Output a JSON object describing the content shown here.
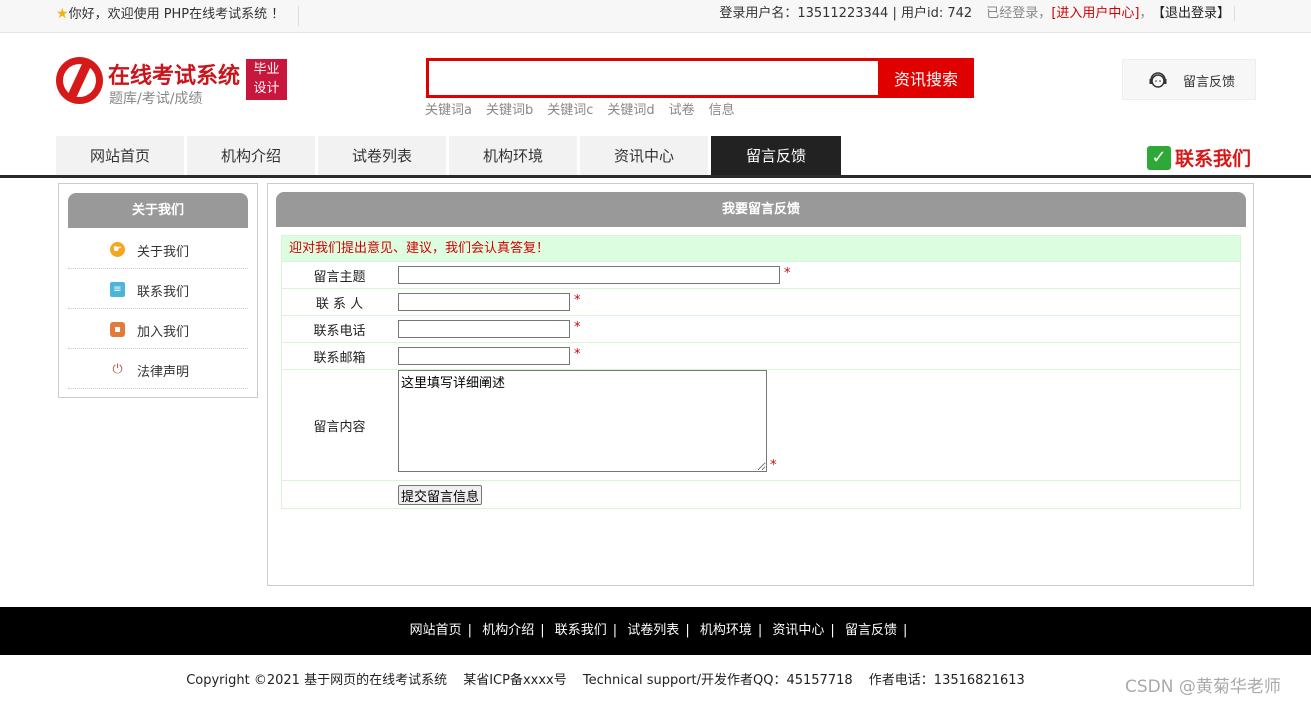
{
  "topbar": {
    "welcome": "你好，欢迎使用 PHP在线考试系统 ！",
    "user_label": "登录用户名：13511223344 | 用户id: 742",
    "logged_in": "已经登录，",
    "user_center": "[进入用户中心]",
    "comma": "，",
    "logout": "【退出登录】"
  },
  "logo": {
    "title": "在线考试系统",
    "subtitle": "题库/考试/成绩",
    "badge_line1": "毕业",
    "badge_line2": "设计"
  },
  "search": {
    "value": "",
    "button": "资讯搜索",
    "keywords": [
      "关键词a",
      "关键词b",
      "关键词c",
      "关键词d",
      "试卷",
      "信息"
    ]
  },
  "feedback_button": "留言反馈",
  "nav": {
    "items": [
      "网站首页",
      "机构介绍",
      "试卷列表",
      "机构环境",
      "资讯中心",
      "留言反馈"
    ],
    "active": "留言反馈",
    "contact": "联系我们"
  },
  "sidebar": {
    "title": "关于我们",
    "items": [
      "关于我们",
      "联系我们",
      "加入我们",
      "法律声明"
    ]
  },
  "main": {
    "title": "我要留言反馈",
    "notice": "迎对我们提出意见、建议，我们会认真答复！",
    "fields": {
      "subject_label": "留言主题",
      "contact_label": "联 系 人",
      "phone_label": "联系电话",
      "email_label": "联系邮箱",
      "content_label": "留言内容",
      "content_value": "这里填写详细阐述",
      "required": "*"
    },
    "submit": "提交留言信息"
  },
  "footer": {
    "links": [
      "网站首页",
      "机构介绍",
      "联系我们",
      "试卷列表",
      "机构环境",
      "资讯中心",
      "留言反馈"
    ],
    "separator": "|",
    "copyright": "Copyright ©2021 基于网页的在线考试系统",
    "icp": "某省ICP备xxxx号",
    "support": "Technical support/开发作者QQ：45157718",
    "phone": "作者电话：13516821613"
  },
  "watermark": "CSDN @黄菊华老师"
}
